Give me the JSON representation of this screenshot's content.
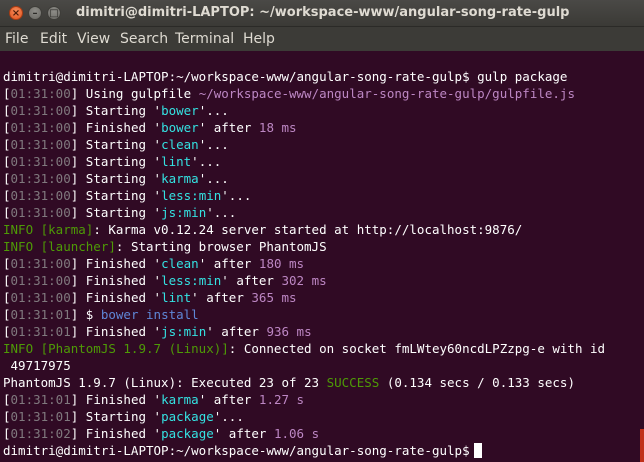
{
  "window": {
    "title": "dimitri@dimitri-LAPTOP: ~/workspace-www/angular-song-rate-gulp",
    "close_glyph": "×",
    "min_glyph": "–",
    "max_glyph": "□"
  },
  "menu": [
    "File",
    "Edit",
    "View",
    "Search",
    "Terminal",
    "Help"
  ],
  "colors": {
    "background": "#300a24",
    "timestamp": "#80797e",
    "task_name": "#34e2e2",
    "path": "#bd87c4",
    "info": "#4e9a06",
    "success": "#4e9a06"
  },
  "terminal": {
    "lines": [
      [
        {
          "t": "dimitri@dimitri-LAPTOP:~/workspace-www/angular-song-rate-gulp$ gulp package",
          "c": "white"
        }
      ],
      [
        {
          "t": "[",
          "c": "white"
        },
        {
          "t": "01:31:00",
          "c": "gray"
        },
        {
          "t": "] Using gulpfile ",
          "c": "white"
        },
        {
          "t": "~/workspace-www/angular-song-rate-gulp/gulpfile.js",
          "c": "mag"
        }
      ],
      [
        {
          "t": "[",
          "c": "white"
        },
        {
          "t": "01:31:00",
          "c": "gray"
        },
        {
          "t": "] Starting '",
          "c": "white"
        },
        {
          "t": "bower",
          "c": "cyan"
        },
        {
          "t": "'...",
          "c": "white"
        }
      ],
      [
        {
          "t": "[",
          "c": "white"
        },
        {
          "t": "01:31:00",
          "c": "gray"
        },
        {
          "t": "] Finished '",
          "c": "white"
        },
        {
          "t": "bower",
          "c": "cyan"
        },
        {
          "t": "' after ",
          "c": "white"
        },
        {
          "t": "18 ms",
          "c": "mag"
        }
      ],
      [
        {
          "t": "[",
          "c": "white"
        },
        {
          "t": "01:31:00",
          "c": "gray"
        },
        {
          "t": "] Starting '",
          "c": "white"
        },
        {
          "t": "clean",
          "c": "cyan"
        },
        {
          "t": "'...",
          "c": "white"
        }
      ],
      [
        {
          "t": "[",
          "c": "white"
        },
        {
          "t": "01:31:00",
          "c": "gray"
        },
        {
          "t": "] Starting '",
          "c": "white"
        },
        {
          "t": "lint",
          "c": "cyan"
        },
        {
          "t": "'...",
          "c": "white"
        }
      ],
      [
        {
          "t": "[",
          "c": "white"
        },
        {
          "t": "01:31:00",
          "c": "gray"
        },
        {
          "t": "] Starting '",
          "c": "white"
        },
        {
          "t": "karma",
          "c": "cyan"
        },
        {
          "t": "'...",
          "c": "white"
        }
      ],
      [
        {
          "t": "[",
          "c": "white"
        },
        {
          "t": "01:31:00",
          "c": "gray"
        },
        {
          "t": "] Starting '",
          "c": "white"
        },
        {
          "t": "less:min",
          "c": "cyan"
        },
        {
          "t": "'...",
          "c": "white"
        }
      ],
      [
        {
          "t": "[",
          "c": "white"
        },
        {
          "t": "01:31:00",
          "c": "gray"
        },
        {
          "t": "] Starting '",
          "c": "white"
        },
        {
          "t": "js:min",
          "c": "cyan"
        },
        {
          "t": "'...",
          "c": "white"
        }
      ],
      [
        {
          "t": "INFO [karma]",
          "c": "green"
        },
        {
          "t": ": Karma v0.12.24 server started at http://localhost:9876/",
          "c": "white"
        }
      ],
      [
        {
          "t": "INFO [launcher]",
          "c": "green"
        },
        {
          "t": ": Starting browser PhantomJS",
          "c": "white"
        }
      ],
      [
        {
          "t": "[",
          "c": "white"
        },
        {
          "t": "01:31:00",
          "c": "gray"
        },
        {
          "t": "] Finished '",
          "c": "white"
        },
        {
          "t": "clean",
          "c": "cyan"
        },
        {
          "t": "' after ",
          "c": "white"
        },
        {
          "t": "180 ms",
          "c": "mag"
        }
      ],
      [
        {
          "t": "[",
          "c": "white"
        },
        {
          "t": "01:31:00",
          "c": "gray"
        },
        {
          "t": "] Finished '",
          "c": "white"
        },
        {
          "t": "less:min",
          "c": "cyan"
        },
        {
          "t": "' after ",
          "c": "white"
        },
        {
          "t": "302 ms",
          "c": "mag"
        }
      ],
      [
        {
          "t": "[",
          "c": "white"
        },
        {
          "t": "01:31:00",
          "c": "gray"
        },
        {
          "t": "] Finished '",
          "c": "white"
        },
        {
          "t": "lint",
          "c": "cyan"
        },
        {
          "t": "' after ",
          "c": "white"
        },
        {
          "t": "365 ms",
          "c": "mag"
        }
      ],
      [
        {
          "t": "[",
          "c": "white"
        },
        {
          "t": "01:31:01",
          "c": "gray"
        },
        {
          "t": "] $ ",
          "c": "white"
        },
        {
          "t": "bower install",
          "c": "blue"
        }
      ],
      [
        {
          "t": "[",
          "c": "white"
        },
        {
          "t": "01:31:01",
          "c": "gray"
        },
        {
          "t": "] Finished '",
          "c": "white"
        },
        {
          "t": "js:min",
          "c": "cyan"
        },
        {
          "t": "' after ",
          "c": "white"
        },
        {
          "t": "936 ms",
          "c": "mag"
        }
      ],
      [
        {
          "t": "INFO [PhantomJS 1.9.7 (Linux)]",
          "c": "green"
        },
        {
          "t": ": Connected on socket fmLWtey60ncdLPZzpg-e with id",
          "c": "white"
        }
      ],
      [
        {
          "t": " 49717975",
          "c": "white"
        }
      ],
      [
        {
          "t": "PhantomJS 1.9.7 (Linux): Executed 23 of 23 ",
          "c": "white"
        },
        {
          "t": "SUCCESS",
          "c": "green"
        },
        {
          "t": " (0.134 secs / 0.133 secs)",
          "c": "white"
        }
      ],
      [
        {
          "t": "[",
          "c": "white"
        },
        {
          "t": "01:31:01",
          "c": "gray"
        },
        {
          "t": "] Finished '",
          "c": "white"
        },
        {
          "t": "karma",
          "c": "cyan"
        },
        {
          "t": "' after ",
          "c": "white"
        },
        {
          "t": "1.27 s",
          "c": "mag"
        }
      ],
      [
        {
          "t": "[",
          "c": "white"
        },
        {
          "t": "01:31:01",
          "c": "gray"
        },
        {
          "t": "] Starting '",
          "c": "white"
        },
        {
          "t": "package",
          "c": "cyan"
        },
        {
          "t": "'...",
          "c": "white"
        }
      ],
      [
        {
          "t": "[",
          "c": "white"
        },
        {
          "t": "01:31:02",
          "c": "gray"
        },
        {
          "t": "] Finished '",
          "c": "white"
        },
        {
          "t": "package",
          "c": "cyan"
        },
        {
          "t": "' after ",
          "c": "white"
        },
        {
          "t": "1.06 s",
          "c": "mag"
        }
      ],
      [
        {
          "t": "dimitri@dimitri-LAPTOP:~/workspace-www/angular-song-rate-gulp$",
          "c": "white"
        }
      ]
    ]
  }
}
